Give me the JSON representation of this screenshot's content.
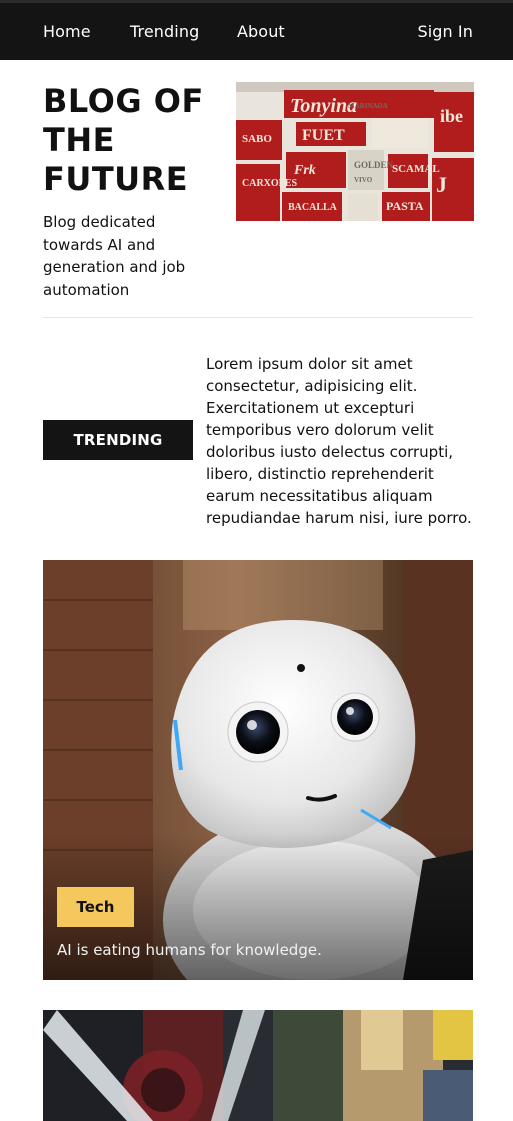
{
  "nav": {
    "home": "Home",
    "trending": "Trending",
    "about": "About",
    "signin": "Sign In"
  },
  "hero": {
    "title": "BLOG OF THE FUTURE",
    "subtitle": "Blog dedicated towards AI and generation and job automation"
  },
  "trending": {
    "label": "TRENDING",
    "text": "Lorem ipsum dolor sit amet consectetur, adipisicing elit. Exercitationem ut excepturi temporibus vero dolorum velit doloribus iusto delectus corrupti, libero, distinctio reprehenderit earum necessitatibus aliquam repudiandae harum nisi, iure porro."
  },
  "card": {
    "tag": "Tech",
    "caption": "AI is eating humans for knowledge."
  },
  "colors": {
    "nav_bg": "#141414",
    "tag_bg": "#f5c85e",
    "poster_red": "#b01f1f"
  },
  "images": {
    "hero_poster": "typographic-poster-image",
    "card_main": "robot-photo",
    "card_secondary": "blurred-street-photo"
  }
}
